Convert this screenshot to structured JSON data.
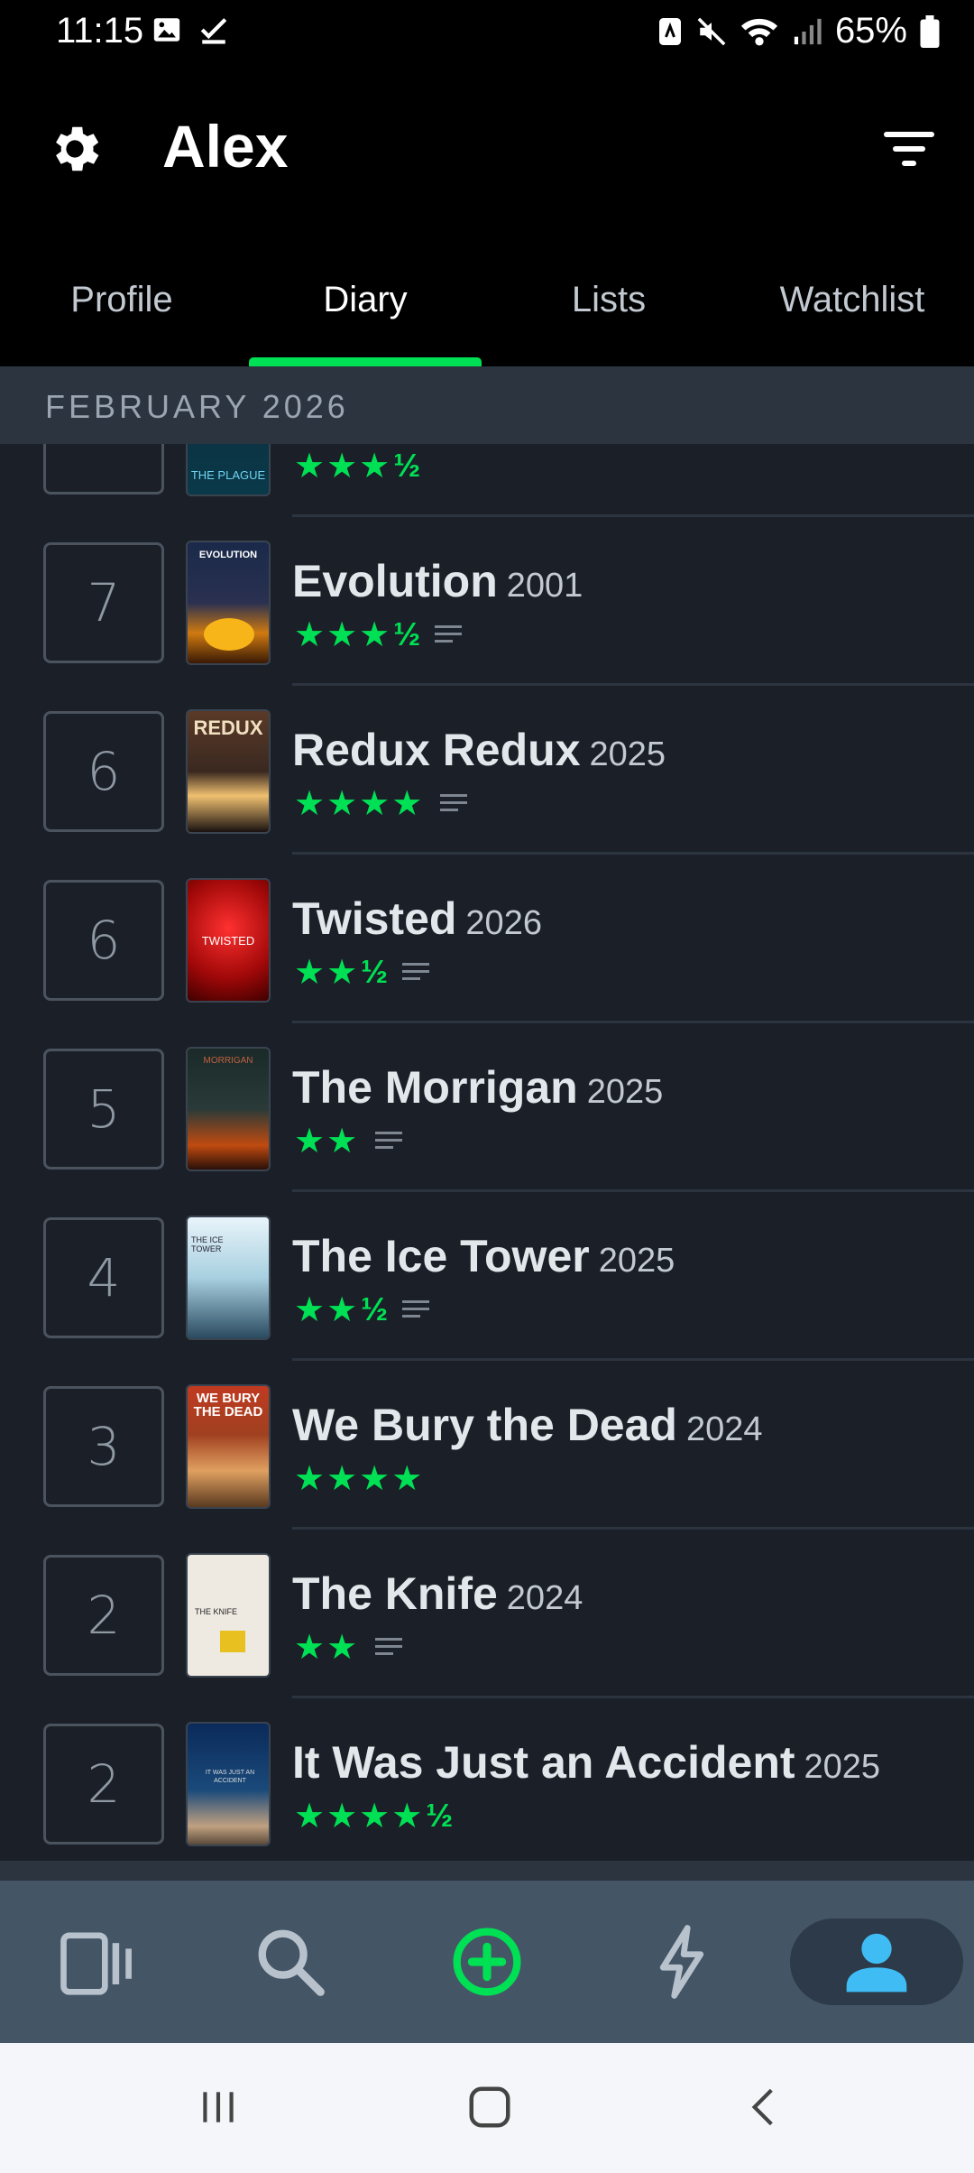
{
  "status_bar": {
    "time": "11:15",
    "battery": "65%"
  },
  "header": {
    "title": "Alex"
  },
  "tabs": [
    {
      "label": "Profile"
    },
    {
      "label": "Diary"
    },
    {
      "label": "Lists"
    },
    {
      "label": "Watchlist"
    }
  ],
  "active_tab": "Diary",
  "section": {
    "title": "FEBRUARY 2026"
  },
  "partial_entry": {
    "poster_text": "THE PLAGUE",
    "stars": "★★★",
    "half": "½"
  },
  "entries": [
    {
      "day": "7",
      "title": "Evolution",
      "year": "2001",
      "stars": "★★★",
      "half": "½",
      "review": true,
      "poster_text": "EVOLUTION"
    },
    {
      "day": "6",
      "title": "Redux Redux",
      "year": "2025",
      "stars": "★★★★",
      "half": "",
      "review": true,
      "poster_text": "REDUX"
    },
    {
      "day": "6",
      "title": "Twisted",
      "year": "2026",
      "stars": "★★",
      "half": "½",
      "review": true,
      "poster_text": "TWISTED"
    },
    {
      "day": "5",
      "title": "The Morrigan",
      "year": "2025",
      "stars": "★★",
      "half": "",
      "review": true,
      "poster_text": "MORRIGAN"
    },
    {
      "day": "4",
      "title": "The Ice Tower",
      "year": "2025",
      "stars": "★★",
      "half": "½",
      "review": true,
      "poster_text": "THE ICE TOWER"
    },
    {
      "day": "3",
      "title": "We Bury the Dead",
      "year": "2024",
      "stars": "★★★★",
      "half": "",
      "review": false,
      "poster_text": "WE BURY THE DEAD"
    },
    {
      "day": "2",
      "title": "The Knife",
      "year": "2024",
      "stars": "★★",
      "half": "",
      "review": true,
      "poster_text": "THE KNIFE"
    },
    {
      "day": "2",
      "title": "It Was Just an Accident",
      "year": "2025",
      "stars": "★★★★",
      "half": "½",
      "review": false,
      "poster_text": "IT WAS JUST AN ACCIDENT"
    }
  ],
  "bottom_nav": [
    {
      "icon": "films-icon"
    },
    {
      "icon": "search-icon"
    },
    {
      "icon": "add-icon"
    },
    {
      "icon": "activity-icon"
    },
    {
      "icon": "profile-icon"
    }
  ],
  "colors": {
    "accent": "#00e054",
    "background": "#1b2028",
    "section": "#2c3440",
    "nav": "#445566",
    "profile_active": "#40bcf4"
  }
}
